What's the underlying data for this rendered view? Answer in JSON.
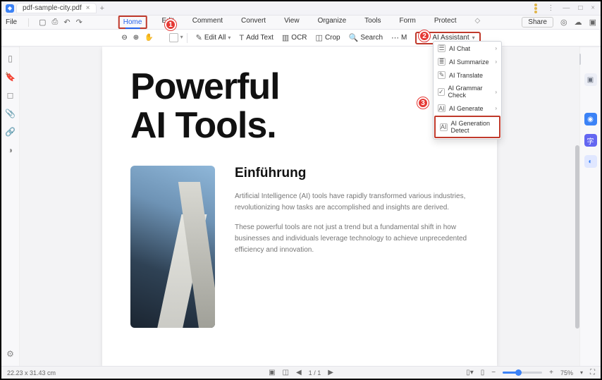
{
  "window": {
    "tab_title": "pdf-sample-city.pdf"
  },
  "menubar": {
    "file_label": "File",
    "ribbon": [
      "Home",
      "Edit",
      "Comment",
      "Convert",
      "View",
      "Organize",
      "Tools",
      "Form",
      "Protect"
    ],
    "share_label": "Share"
  },
  "toolbar": {
    "edit_all": "Edit All",
    "add_text": "Add Text",
    "ocr": "OCR",
    "crop": "Crop",
    "search": "Search",
    "more": "M",
    "ai_assistant": "AI Assistant"
  },
  "ai_menu": {
    "items": [
      {
        "label": "AI Chat",
        "icon": "💬",
        "sub": true
      },
      {
        "label": "AI Summarize",
        "icon": "≣",
        "sub": true
      },
      {
        "label": "AI Translate",
        "icon": "✎",
        "sub": false
      },
      {
        "label": "AI Grammar Check",
        "icon": "✓",
        "sub": true
      },
      {
        "label": "AI Generate",
        "icon": "AI",
        "sub": true
      },
      {
        "label": "AI Generation Detect",
        "icon": "AI",
        "sub": false
      }
    ]
  },
  "document": {
    "title_line1": "Powerful",
    "title_line2": "AI Tools.",
    "section_heading": "Einführung",
    "para1": "Artificial Intelligence (AI) tools have rapidly transformed various industries, revolutionizing how tasks are accomplished and insights are derived.",
    "para2": "These powerful tools are not just a trend but a fundamental shift in how businesses and individuals leverage technology to achieve unprecedented efficiency and innovation."
  },
  "statusbar": {
    "page_dim": "22.23 x 31.43 cm",
    "page_current": "1",
    "page_total": "1",
    "zoom": "75%"
  },
  "callouts": {
    "c1": "1",
    "c2": "2",
    "c3": "3"
  }
}
